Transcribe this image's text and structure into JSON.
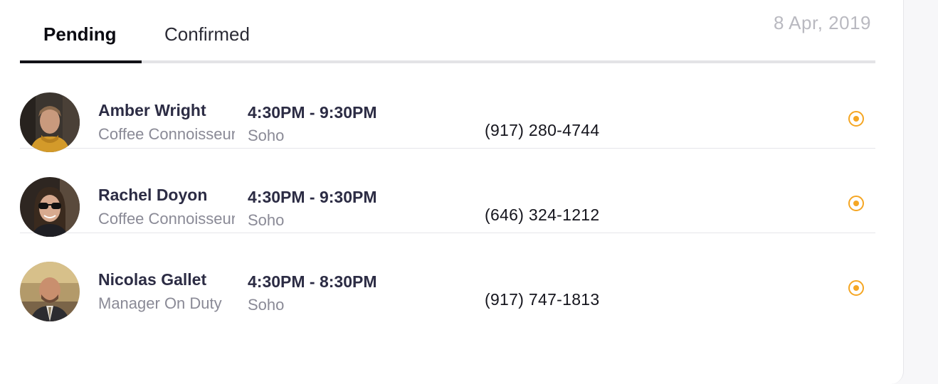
{
  "tabs": {
    "pending": "Pending",
    "confirmed": "Confirmed",
    "active": "Pending"
  },
  "date": "8 Apr, 2019",
  "colors": {
    "accent": "#f5a623",
    "name_text": "#2c2c44",
    "muted_text": "#8a8a96",
    "date_text": "#b9b9c0"
  },
  "shifts": [
    {
      "name": "Amber Wright",
      "role": "Coffee Connoisseur",
      "time": "4:30PM - 9:30PM",
      "location": "Soho",
      "phone": "(917) 280-4744",
      "avatar": "avatar-photo"
    },
    {
      "name": "Rachel Doyon",
      "role": "Coffee Connoisseur",
      "time": "4:30PM - 9:30PM",
      "location": "Soho",
      "phone": "(646) 324-1212",
      "avatar": "avatar-photo"
    },
    {
      "name": "Nicolas Gallet",
      "role": "Manager On Duty",
      "time": "4:30PM - 8:30PM",
      "location": "Soho",
      "phone": "(917) 747-1813",
      "avatar": "avatar-photo"
    }
  ]
}
